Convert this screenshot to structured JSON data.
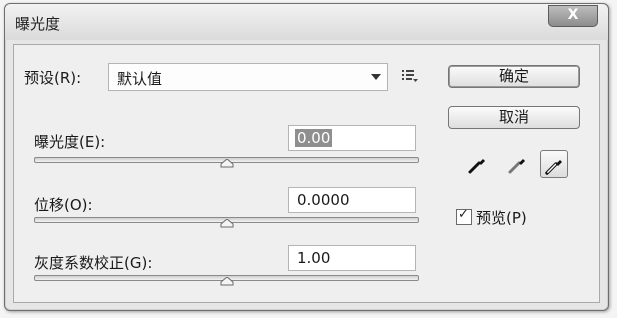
{
  "window": {
    "title": "曝光度",
    "close_label": "X"
  },
  "preset": {
    "label": "预设(R):",
    "value": "默认值"
  },
  "exposure": {
    "label": "曝光度(E):",
    "value": "0.00",
    "slider_fraction": 0.5
  },
  "offset": {
    "label": "位移(O):",
    "value": "0.0000",
    "slider_fraction": 0.5
  },
  "gamma": {
    "label": "灰度系数校正(G):",
    "value": "1.00",
    "slider_fraction": 0.5
  },
  "buttons": {
    "ok": "确定",
    "cancel": "取消"
  },
  "eyedroppers": [
    {
      "icon": "black-point-eyedropper-icon",
      "active": false
    },
    {
      "icon": "gray-point-eyedropper-icon",
      "active": false
    },
    {
      "icon": "white-point-eyedropper-icon",
      "active": true
    }
  ],
  "preview": {
    "label": "预览(P)",
    "checked": true
  },
  "colors": {
    "dialog_background": "#e6e6e6",
    "selection_highlight": "#8f8f8f"
  }
}
